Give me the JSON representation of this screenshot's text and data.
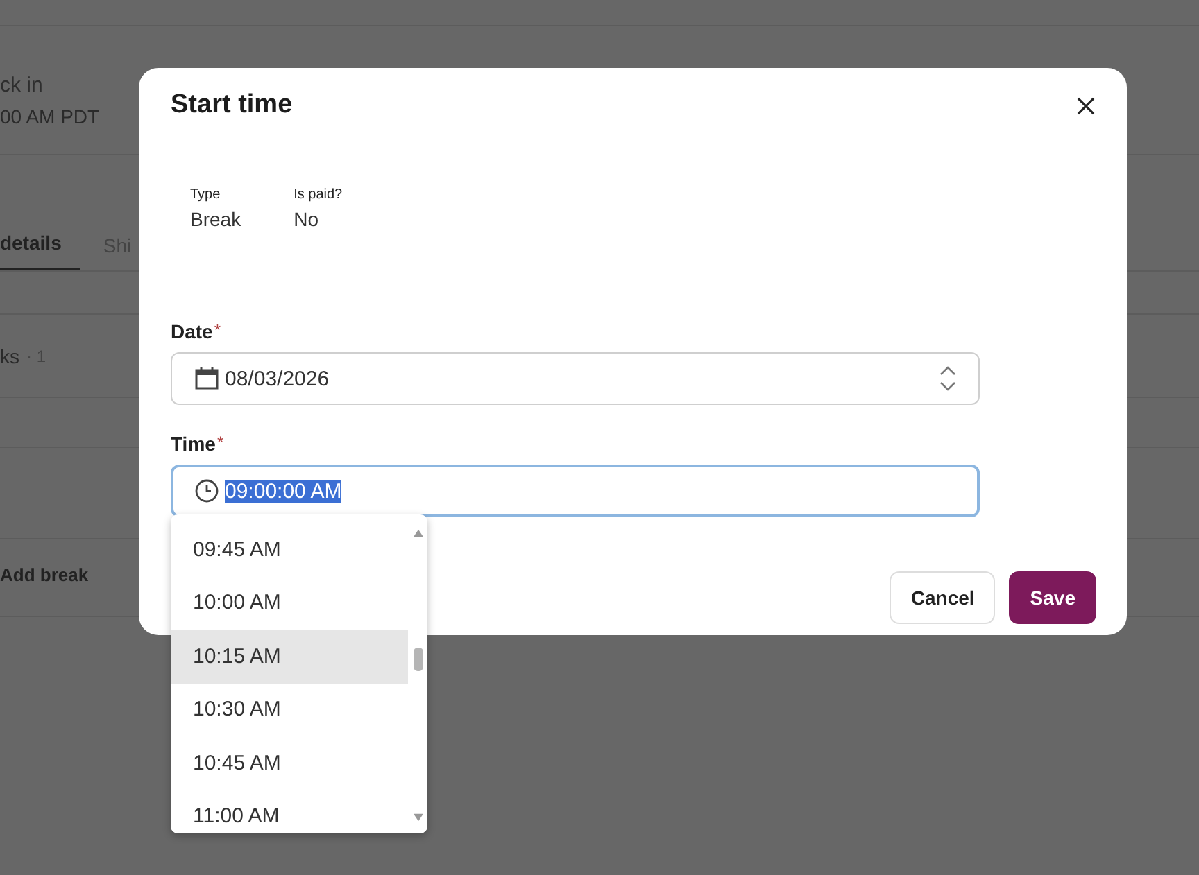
{
  "background_page": {
    "clock_in_label": "ck in",
    "clock_in_value": "00 AM PDT",
    "tabs": [
      {
        "label": "details",
        "selected": true
      },
      {
        "label": "Shi",
        "selected": false
      }
    ],
    "breaks_label": "ks",
    "breaks_count": "· 1",
    "add_break": "Add break"
  },
  "dialog": {
    "title": "Start time",
    "info": [
      {
        "label": "Type",
        "value": "Break"
      },
      {
        "label": "Is paid?",
        "value": "No"
      }
    ],
    "date": {
      "label": "Date",
      "required_mark": "*",
      "value": "08/03/2026"
    },
    "time": {
      "label": "Time",
      "required_mark": "*",
      "value": "09:00:00 AM",
      "focused": true,
      "value_selected": true
    },
    "buttons": [
      {
        "label": "Cancel",
        "kind": "secondary"
      },
      {
        "label": "Save",
        "kind": "primary"
      }
    ]
  },
  "time_dropdown": {
    "options": [
      {
        "label": "09:45 AM",
        "selected": false
      },
      {
        "label": "10:00 AM",
        "selected": false
      },
      {
        "label": "10:15 AM",
        "selected": true
      },
      {
        "label": "10:30 AM",
        "selected": false
      },
      {
        "label": "10:45 AM",
        "selected": false
      },
      {
        "label": "11:00 AM",
        "selected": false
      }
    ]
  }
}
